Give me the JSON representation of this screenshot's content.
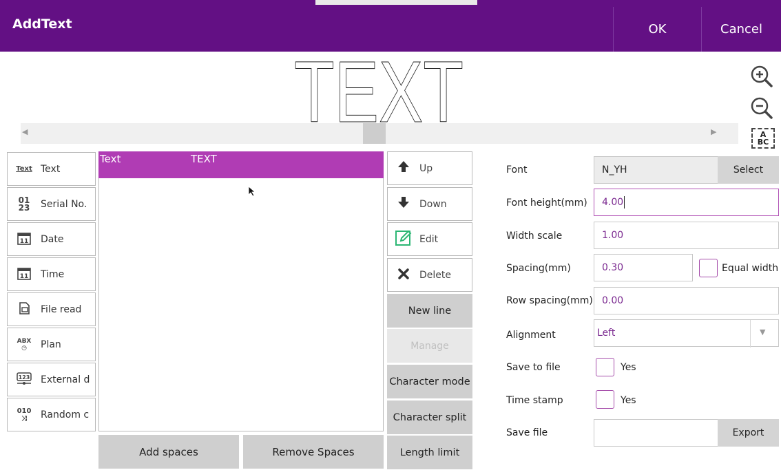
{
  "header": {
    "title": "AddText",
    "ok_label": "OK",
    "cancel_label": "Cancel"
  },
  "preview": {
    "text": "TEXT"
  },
  "types": [
    {
      "label": "Text",
      "icon": "text-icon"
    },
    {
      "label": "Serial No.",
      "icon": "serial-number-icon"
    },
    {
      "label": "Date",
      "icon": "calendar-icon"
    },
    {
      "label": "Time",
      "icon": "calendar-icon"
    },
    {
      "label": "File read",
      "icon": "file-read-icon"
    },
    {
      "label": "Plan",
      "icon": "plan-icon"
    },
    {
      "label": "External d",
      "icon": "external-data-icon"
    },
    {
      "label": "Random c",
      "icon": "random-icon"
    }
  ],
  "list": {
    "row": {
      "type": "Text",
      "content": "TEXT"
    }
  },
  "list_buttons": {
    "add_spaces": "Add spaces",
    "remove_spaces": "Remove Spaces"
  },
  "actions": {
    "up": "Up",
    "down": "Down",
    "edit": "Edit",
    "delete": "Delete",
    "new_line": "New line",
    "manage": "Manage",
    "character_mode": "Character mode",
    "character_split": "Character split",
    "length_limit": "Length limit"
  },
  "properties": {
    "font_label": "Font",
    "font_value": "N_YH",
    "select_label": "Select",
    "font_height_label": "Font height(mm)",
    "font_height_value": "4.00",
    "width_scale_label": "Width scale",
    "width_scale_value": "1.00",
    "spacing_label": "Spacing(mm)",
    "spacing_value": "0.30",
    "equal_width_label": "Equal width",
    "row_spacing_label": "Row spacing(mm)",
    "row_spacing_value": "0.00",
    "alignment_label": "Alignment",
    "alignment_value": "Left",
    "save_to_file_label": "Save to file",
    "save_to_file_yes": "Yes",
    "time_stamp_label": "Time stamp",
    "time_stamp_yes": "Yes",
    "save_file_label": "Save file",
    "save_file_value": "",
    "export_label": "Export"
  },
  "colors": {
    "title_bar": "#631084",
    "selected_row": "#b03cb4",
    "accent": "#a54caa"
  }
}
